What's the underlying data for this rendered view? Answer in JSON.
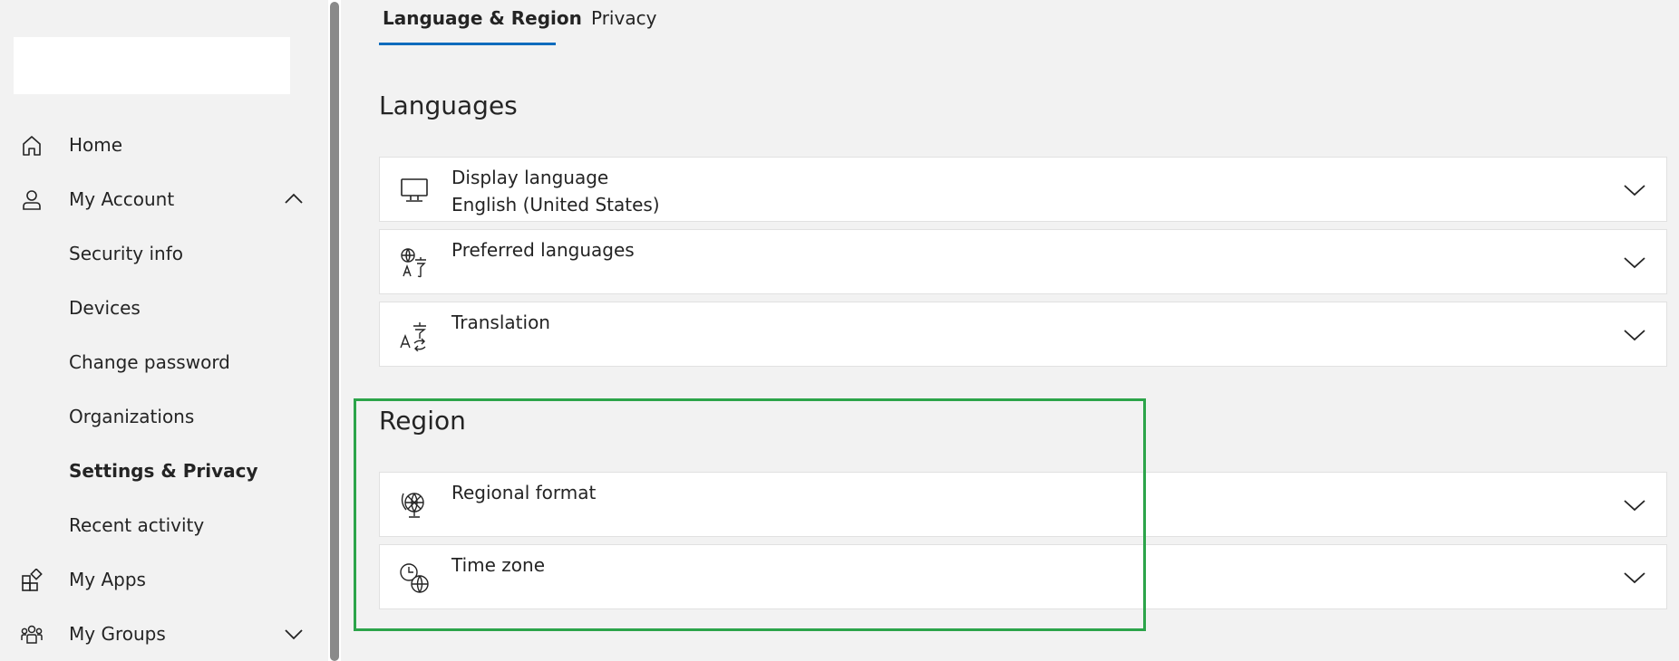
{
  "sidebar": {
    "items": [
      {
        "label": "Home"
      },
      {
        "label": "My Account"
      },
      {
        "label": "Security info"
      },
      {
        "label": "Devices"
      },
      {
        "label": "Change password"
      },
      {
        "label": "Organizations"
      },
      {
        "label": "Settings & Privacy"
      },
      {
        "label": "Recent activity"
      },
      {
        "label": "My Apps"
      },
      {
        "label": "My Groups"
      }
    ]
  },
  "tabs": [
    {
      "label": "Language & Region",
      "active": true
    },
    {
      "label": "Privacy",
      "active": false
    }
  ],
  "languages": {
    "title": "Languages",
    "cards": [
      {
        "title": "Display language",
        "value": "English (United States)",
        "icon": "monitor-icon"
      },
      {
        "title": "Preferred languages",
        "value": "",
        "icon": "language-icon"
      },
      {
        "title": "Translation",
        "value": "",
        "icon": "translate-icon"
      }
    ]
  },
  "region": {
    "title": "Region",
    "cards": [
      {
        "title": "Regional format",
        "value": "",
        "icon": "globe-format-icon"
      },
      {
        "title": "Time zone",
        "value": "",
        "icon": "clock-globe-icon"
      }
    ]
  },
  "colors": {
    "accent": "#0f6cbd",
    "highlight": "#2ca44a",
    "background": "#f2f2f2",
    "card": "#ffffff"
  }
}
